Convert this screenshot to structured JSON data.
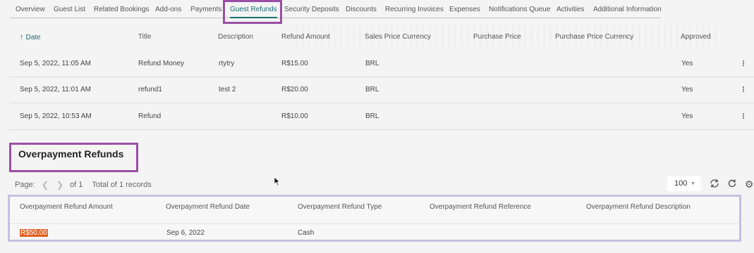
{
  "tabs": [
    {
      "label": "Overview",
      "active": false
    },
    {
      "label": "Guest List",
      "active": false
    },
    {
      "label": "Related Bookings",
      "active": false
    },
    {
      "label": "Add-ons",
      "active": false
    },
    {
      "label": "Payments",
      "active": false
    },
    {
      "label": "Guest Refunds",
      "active": true
    },
    {
      "label": "Security Deposits",
      "active": false
    },
    {
      "label": "Discounts",
      "active": false
    },
    {
      "label": "Recurring Invoices",
      "active": false
    },
    {
      "label": "Expenses",
      "active": false
    },
    {
      "label": "Notifications Queue",
      "active": false
    },
    {
      "label": "Activities",
      "active": false
    },
    {
      "label": "Additional Information",
      "active": false
    }
  ],
  "refunds": {
    "columns": [
      "Date",
      "Title",
      "Description",
      "Refund Amount",
      "Sales Price Currency",
      "Purchase Price",
      "Purchase Price Currency",
      "Approved"
    ],
    "sort_icon": "arrow-up-icon",
    "rows": [
      {
        "date": "Sep 5, 2022, 11:05 AM",
        "title": "Refund Money",
        "description": "rtytry",
        "amount": "R$15.00",
        "currency": "BRL",
        "purchase_price": "",
        "purchase_currency": "",
        "approved": "Yes"
      },
      {
        "date": "Sep 5, 2022, 11:01 AM",
        "title": "refund1",
        "description": "test 2",
        "amount": "R$20.00",
        "currency": "BRL",
        "purchase_price": "",
        "purchase_currency": "",
        "approved": "Yes"
      },
      {
        "date": "Sep 5, 2022, 10:53 AM",
        "title": "Refund",
        "description": "",
        "amount": "R$10.00",
        "currency": "BRL",
        "purchase_price": "",
        "purchase_currency": "",
        "approved": "Yes"
      }
    ]
  },
  "overpayment": {
    "title": "Overpayment Refunds",
    "pager": {
      "label": "Page:",
      "of_text": "of 1",
      "total_text": "Total of 1 records",
      "page_size": "100"
    },
    "columns": [
      "Overpayment Refund Amount",
      "Overpayment Refund Date",
      "Overpayment Refund Type",
      "Overpayment Refund Reference",
      "Overpayment Refund Description"
    ],
    "rows": [
      {
        "amount": "R$50.00",
        "date": "Sep 6, 2022",
        "type": "Cash",
        "reference": "",
        "description": ""
      }
    ]
  },
  "colors": {
    "accent": "#1e6d73",
    "highlight_box": "#9a4fa4",
    "table_box": "#c6bfe0",
    "amount_highlight": "#e2611f"
  }
}
